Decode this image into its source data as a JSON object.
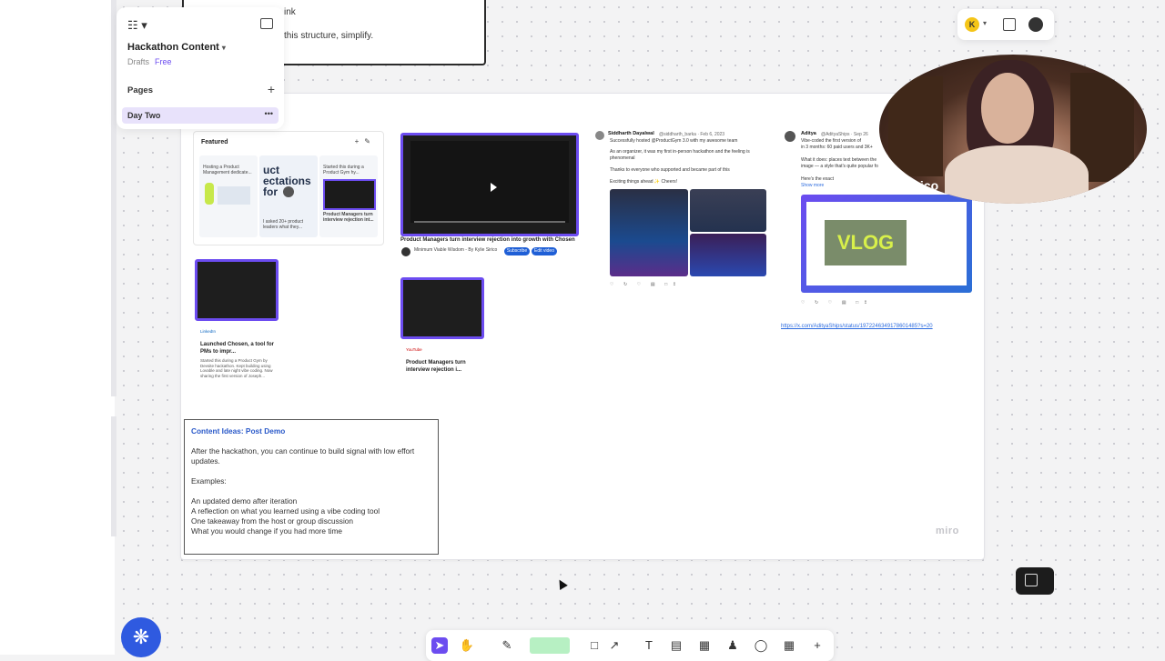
{
  "top_frame": {
    "line1": "ink",
    "line2": "this structure, simplify."
  },
  "pages_panel": {
    "board_title": "Hackathon Content",
    "drafts_label": "Drafts",
    "plan_label": "Free",
    "pages_heading": "Pages",
    "current_page": "Day Two",
    "page_more": "•••"
  },
  "top_right": {
    "avatar_initial": "K"
  },
  "webcam": {
    "name_overlay": "esirico"
  },
  "featured": {
    "heading": "Featured",
    "card1_text": "Hosting a Product Management dedicate...",
    "card2_big": "uct ectations for",
    "card2_text": "I asked 20+ product leaders what they...",
    "card3_text": "Started this during a Product Gym hy...",
    "card3_caption": "Product Managers turn interview rejection int..."
  },
  "video_main": {
    "caption": "Product Managers turn interview rejection into growth with Chosen",
    "channel": "Minimum Viable Wisdom - By Kylie Sirico",
    "pill1": "Subscribe",
    "pill2": "Edit video"
  },
  "tweet1": {
    "name": "Siddharth Dayalwal",
    "handle": "@siddharth_barka · Feb 6, 2023",
    "line1": "Successfully hosted @ProductGym 3.0 with my awesome team",
    "line2": "As an organizer, it was my first in-person hackathon and the feeling is phenomenal",
    "line3": "Thanks to everyone who supported and became part of this",
    "line4": "Exciting things ahead ✨ Cheers!"
  },
  "tweet2": {
    "name": "Aditya",
    "handle": "@AdityaShips · Sep 26",
    "line1": "Vibe-coded the first version of",
    "line2": "in 3 months: 60 paid users and 3K+",
    "line3": "What it does: places text between the",
    "line4": "image — a style that's quite popular fo",
    "line5": "Here's the exact",
    "line6": "Show more",
    "thumb_text": "VLOG"
  },
  "link": "https://x.com/AdityaShips/status/1972246349178601485?s=20",
  "linkedin_card": {
    "source": "LinkedIn",
    "title": "Launched Chosen, a tool for PMs to impr...",
    "meta": "Started this during a Product Gym by Devsite hackathon. Kept building using Lovable and late night vibe coding. Now sharing the first version of Joseph..."
  },
  "youtube_card": {
    "source": "YouTube",
    "title": "Product Managers turn interview rejection i..."
  },
  "note": {
    "title": "Content Ideas: Post Demo",
    "para1_line1": "After the hackathon, you can continue to build signal with low effort",
    "para1_line2": "updates.",
    "examples_label": "Examples:",
    "items": [
      "An updated demo after iteration",
      "A reflection on what you learned using a vibe coding tool",
      "One takeaway from the host or group discussion",
      "What you would change if you had more time"
    ]
  },
  "watermark": "miro",
  "toolbar": {
    "tools": [
      "select-icon",
      "hand-icon",
      "pen-icon",
      "sticky-note-icon",
      "shape-icon",
      "connector-icon",
      "text-icon",
      "frame-icon",
      "table-icon",
      "stamp-icon",
      "comment-icon",
      "apps-icon",
      "add-icon"
    ],
    "text_glyph": "T",
    "plus_glyph": "+"
  },
  "accent": "#6c4cf0",
  "fab_color": "#2f5ae0"
}
